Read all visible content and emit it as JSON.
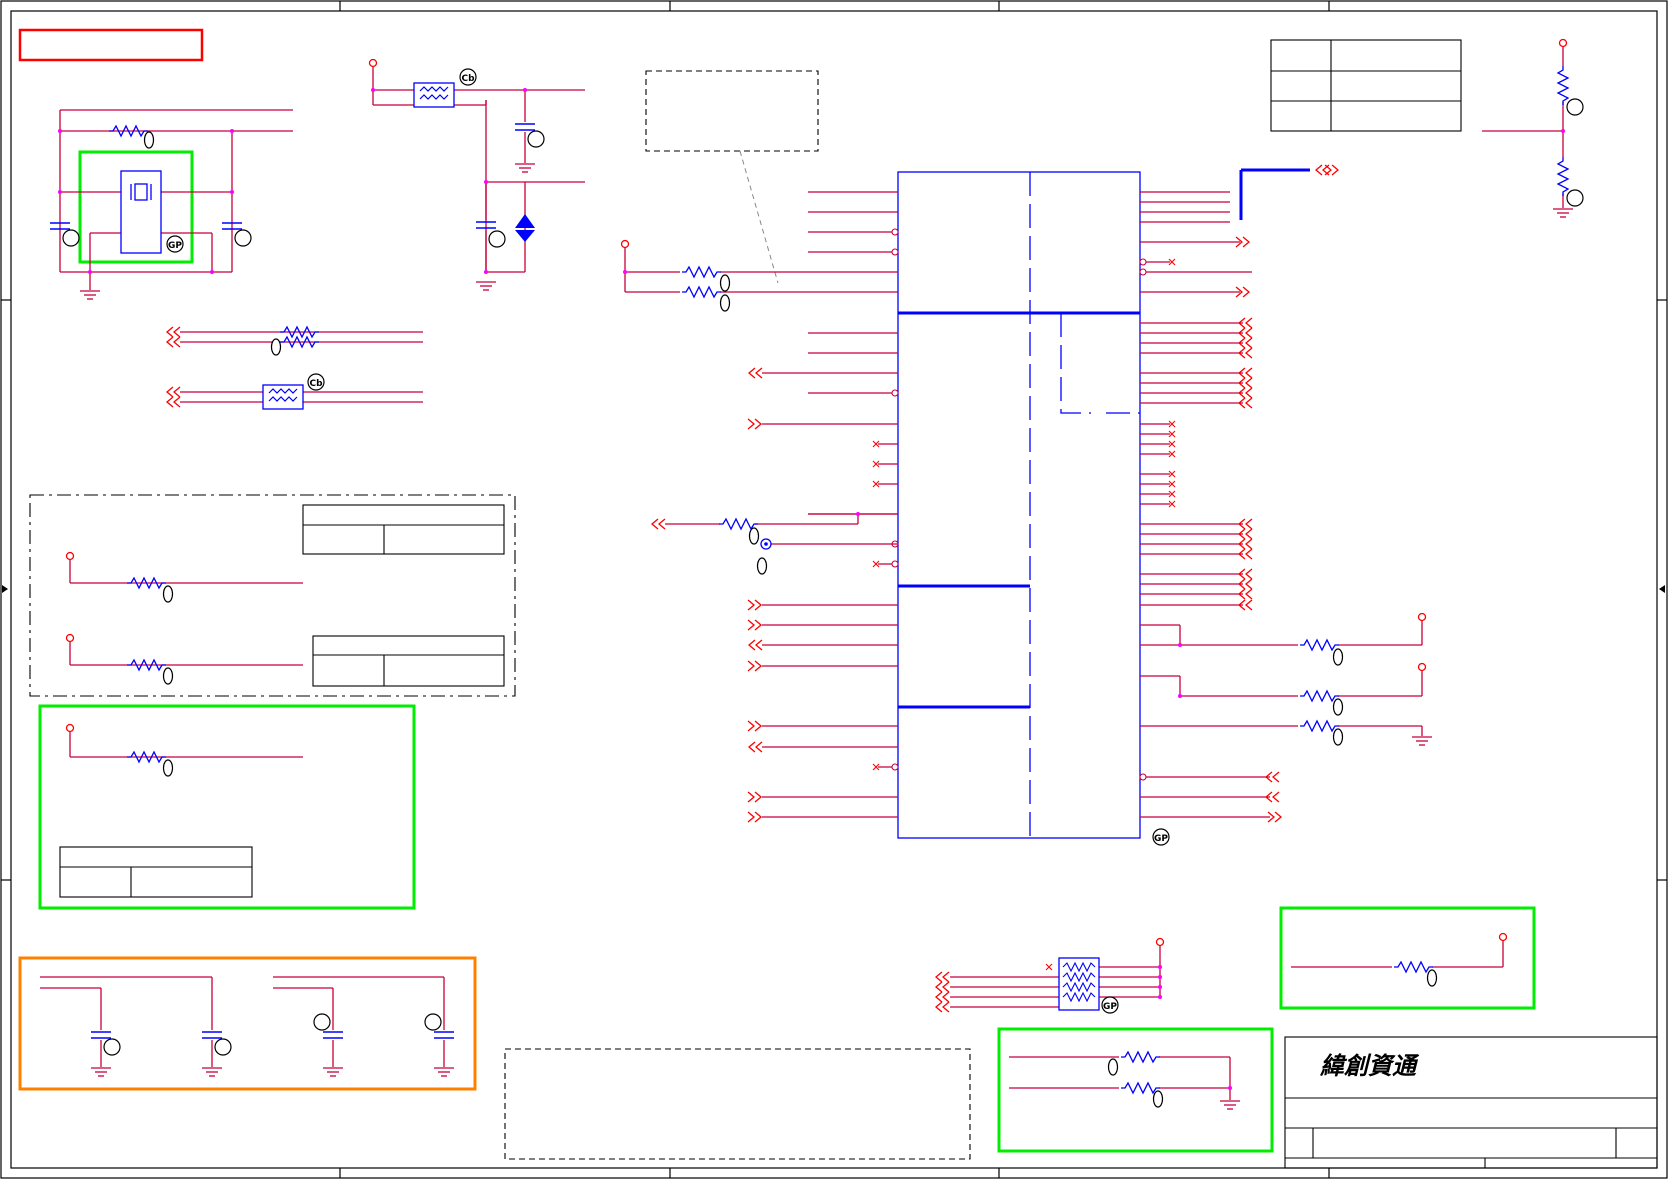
{
  "title_block": {
    "company": "緯創資通"
  },
  "part_tags": {
    "gp": "GP",
    "cb": "Cb"
  },
  "colors": {
    "frame": "#000000",
    "wire": "#c8003c",
    "part": "#0000ff",
    "junction": "#ff00ff",
    "port": "#ff0000",
    "green_box": "#00ee00",
    "orange_box": "#ff8000",
    "red_box": "#ff0000"
  },
  "icons": [
    "resistor-icon",
    "capacitor-icon",
    "crystal-icon",
    "ferrite-bead-icon",
    "resistor-array-icon",
    "tvs-diode-icon",
    "ground-icon",
    "power-rail-icon",
    "offpage-port-icon",
    "no-connect-icon",
    "test-point-icon"
  ]
}
